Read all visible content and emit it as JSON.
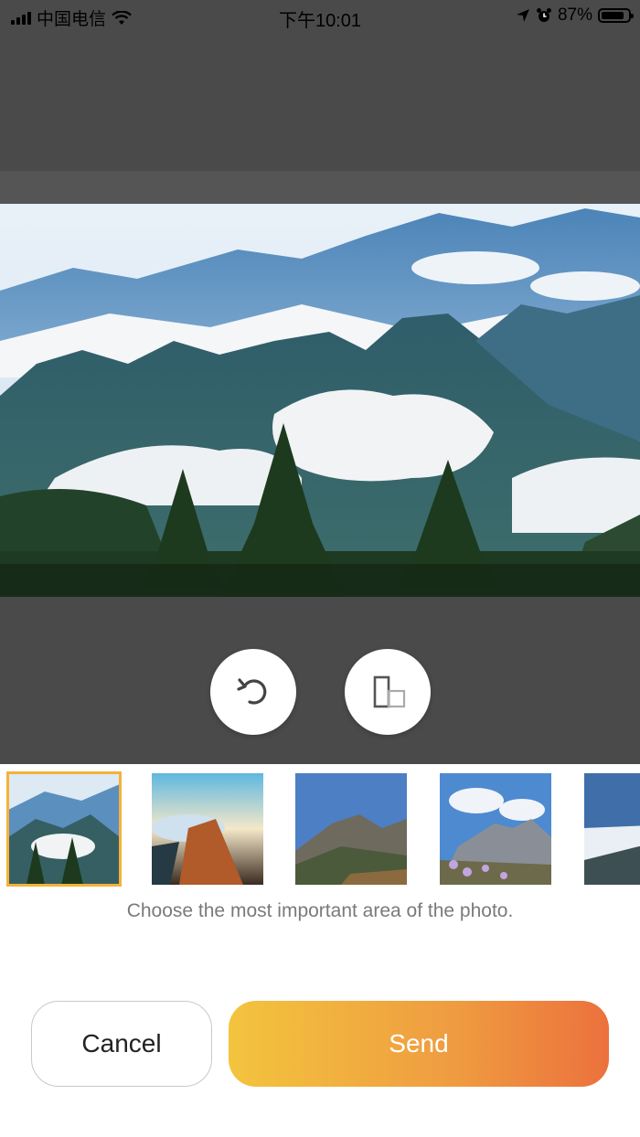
{
  "status_bar": {
    "carrier": "中国电信",
    "time": "下午10:01",
    "battery": "87%",
    "battery_level": 0.87,
    "icons": [
      "signal-icon",
      "wifi-icon",
      "location-icon",
      "alarm-icon",
      "battery-icon"
    ]
  },
  "editor": {
    "tools": [
      {
        "name": "rotate-icon"
      },
      {
        "name": "layout-toggle-icon"
      }
    ]
  },
  "thumbnails": [
    {
      "name": "thumbnail-1",
      "selected": true
    },
    {
      "name": "thumbnail-2",
      "selected": false
    },
    {
      "name": "thumbnail-3",
      "selected": false
    },
    {
      "name": "thumbnail-4",
      "selected": false
    },
    {
      "name": "thumbnail-5",
      "selected": false
    }
  ],
  "hint": "Choose the most important area of the photo.",
  "actions": {
    "cancel": "Cancel",
    "send": "Send"
  },
  "colors": {
    "selected_border": "#f3b23a",
    "send_gradient_start": "#f3c43e",
    "send_gradient_end": "#ec713d",
    "editor_background": "#4a4a4a"
  }
}
